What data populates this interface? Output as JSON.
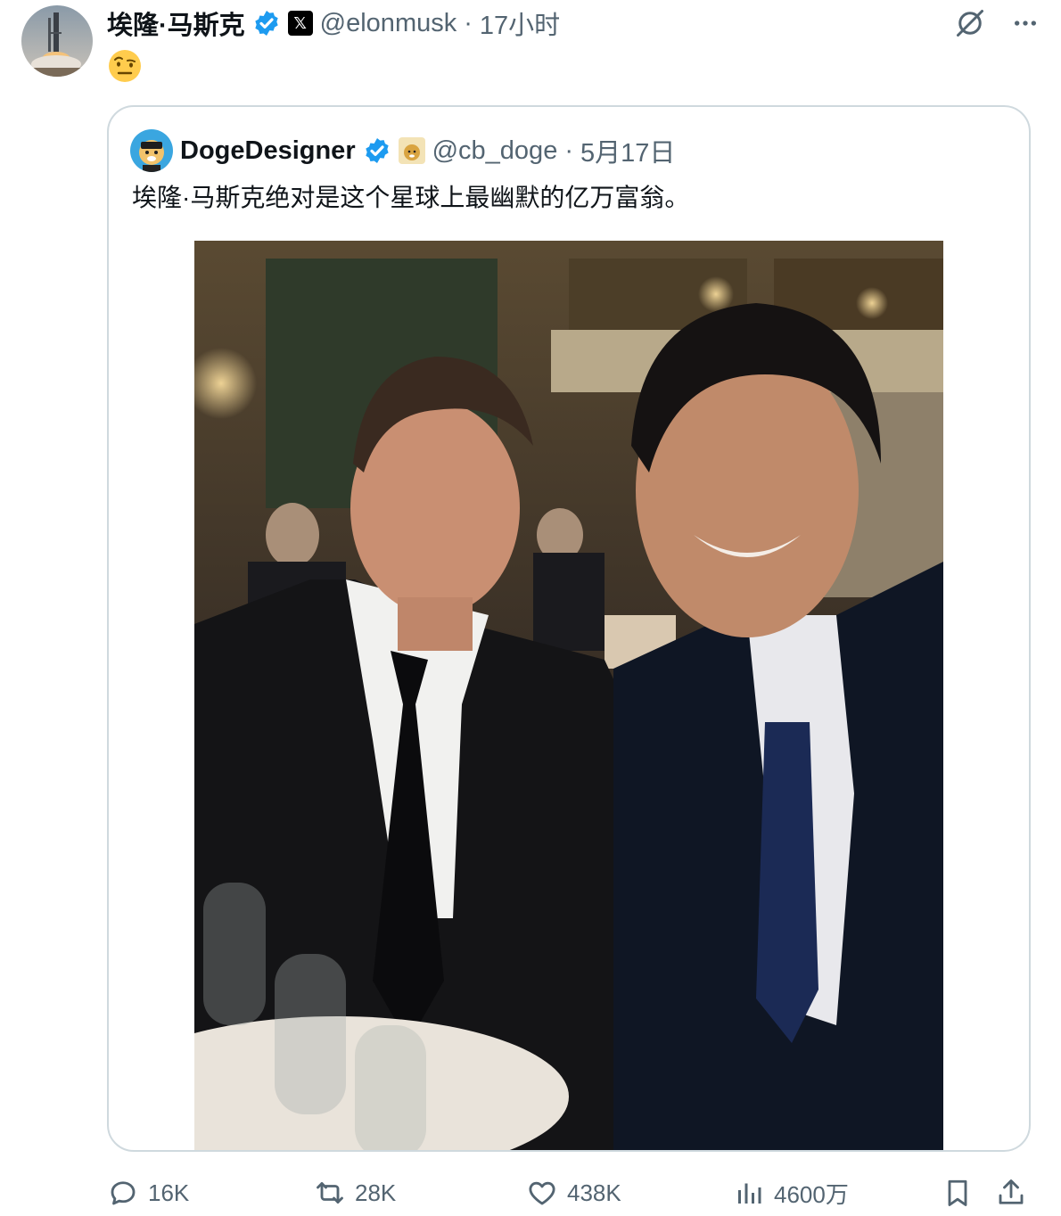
{
  "tweet": {
    "author_name": "埃隆·马斯克",
    "handle": "@elonmusk",
    "separator": "·",
    "time": "17小时",
    "x_badge": "𝕏",
    "emoji_icon": "face-with-raised-eyebrow-icon",
    "verified_color": "#1d9bf0"
  },
  "quoted": {
    "author_name": "DogeDesigner",
    "handle": "@cb_doge",
    "separator": "·",
    "date": "5月17日",
    "text": "埃隆·马斯克绝对是这个星球上最幽默的亿万富翁。",
    "photo_icon": "photo-two-men-selfie-at-dinner"
  },
  "actions": {
    "replies": "16K",
    "reposts": "28K",
    "likes": "438K",
    "views": "4600万"
  },
  "colors": {
    "text": "#0f1419",
    "muted": "#536471",
    "border": "#cfd9de",
    "accent": "#1d9bf0"
  }
}
